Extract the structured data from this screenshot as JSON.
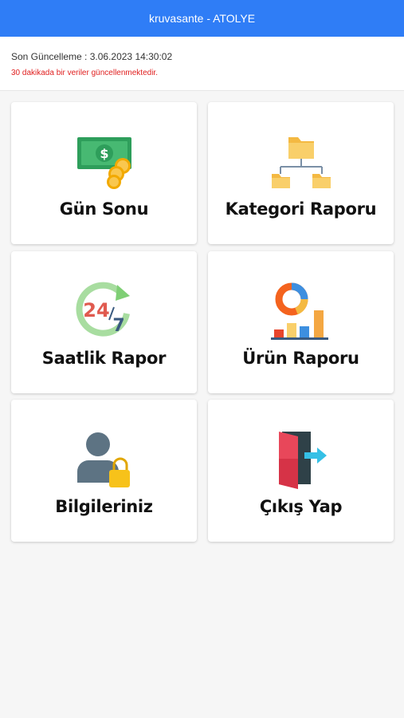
{
  "header": {
    "title": "kruvasante - ATOLYE"
  },
  "status": {
    "last_update": "Son Güncelleme : 3.06.2023 14:30:02",
    "notice": "30 dakikada bir veriler güncellenmektedir."
  },
  "menu": [
    {
      "label": "Gün Sonu",
      "icon": "money-icon"
    },
    {
      "label": "Kategori Raporu",
      "icon": "folder-tree-icon"
    },
    {
      "label": "Saatlik Rapor",
      "icon": "24-7-icon"
    },
    {
      "label": "Ürün Raporu",
      "icon": "chart-icon"
    },
    {
      "label": "Bilgileriniz",
      "icon": "user-lock-icon"
    },
    {
      "label": "Çıkış Yap",
      "icon": "exit-door-icon"
    }
  ],
  "colors": {
    "accent": "#2f7df6",
    "notice": "#e02020"
  }
}
